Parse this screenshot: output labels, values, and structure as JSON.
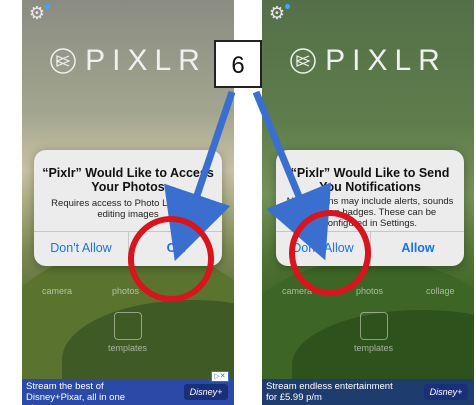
{
  "callout": {
    "step": "6"
  },
  "left": {
    "logo": "PIXLR",
    "dialog": {
      "title": "“Pixlr” Would Like to Access Your Photos",
      "message": "Requires access to Photo Library for editing images",
      "buttons": [
        "Don't Allow",
        "OK"
      ]
    },
    "tools": [
      "camera",
      "photos",
      "templates"
    ],
    "ad": {
      "text": "Stream the best of Disney+Pixar, all in one place",
      "brand": "Disney+"
    }
  },
  "right": {
    "logo": "PIXLR",
    "dialog": {
      "title": "“Pixlr” Would Like to Send You Notifications",
      "message": "Notifications may include alerts, sounds and icon badges. These can be configured in Settings.",
      "buttons": [
        "Don't Allow",
        "Allow"
      ]
    },
    "tools": [
      "camera",
      "photos",
      "collage",
      "templates"
    ],
    "ad": {
      "text": "Stream endless entertainment for £5.99 p/m",
      "brand": "Disney+"
    }
  },
  "colors": {
    "ring": "#d8141c",
    "arrow": "#3a6fd0",
    "button": "#1a73e8"
  }
}
